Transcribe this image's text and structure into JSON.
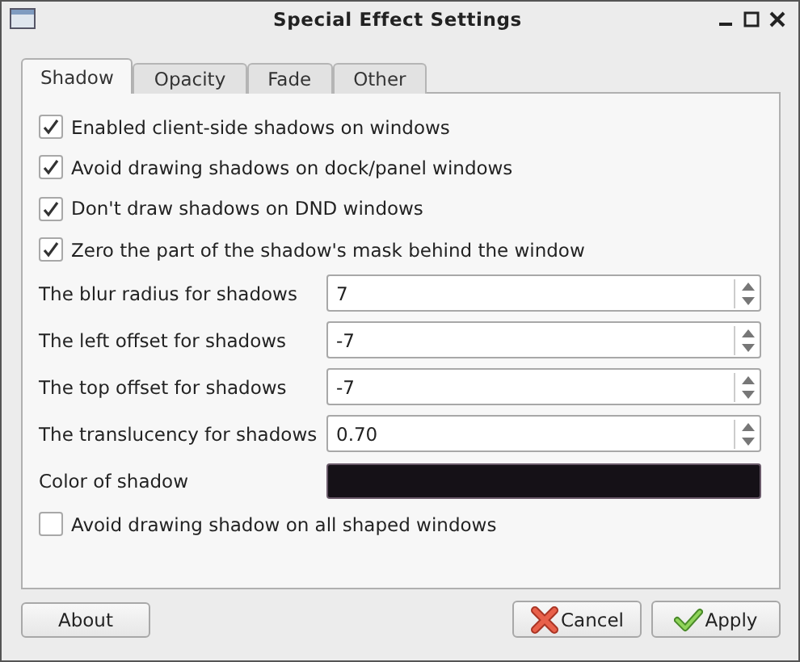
{
  "window": {
    "title": "Special Effect Settings"
  },
  "tabs": [
    {
      "label": "Shadow",
      "selected": true
    },
    {
      "label": "Opacity",
      "selected": false
    },
    {
      "label": "Fade",
      "selected": false
    },
    {
      "label": "Other",
      "selected": false
    }
  ],
  "options": [
    {
      "kind": "checkbox",
      "label": "Enabled client-side shadows on windows",
      "checked": true
    },
    {
      "kind": "checkbox",
      "label": "Avoid drawing shadows on dock/panel windows",
      "checked": true
    },
    {
      "kind": "checkbox",
      "label": "Don't draw shadows on DND windows",
      "checked": true
    },
    {
      "kind": "checkbox",
      "label": "Zero the part of the shadow's mask behind the window",
      "checked": true
    },
    {
      "kind": "spin",
      "label": "The blur radius for shadows",
      "value": "7"
    },
    {
      "kind": "spin",
      "label": "The left offset for shadows",
      "value": "-7"
    },
    {
      "kind": "spin",
      "label": "The top offset for shadows",
      "value": "-7"
    },
    {
      "kind": "spin",
      "label": "The translucency for shadows",
      "value": "0.70"
    },
    {
      "kind": "color",
      "label": "Color of shadow",
      "color": "#151117"
    },
    {
      "kind": "checkbox",
      "label": "Avoid drawing shadow on all shaped windows",
      "checked": false
    }
  ],
  "buttons": [
    {
      "kind": "plain",
      "label": "About"
    },
    {
      "kind": "cancel",
      "label": "Cancel"
    },
    {
      "kind": "apply",
      "label": "Apply"
    }
  ]
}
